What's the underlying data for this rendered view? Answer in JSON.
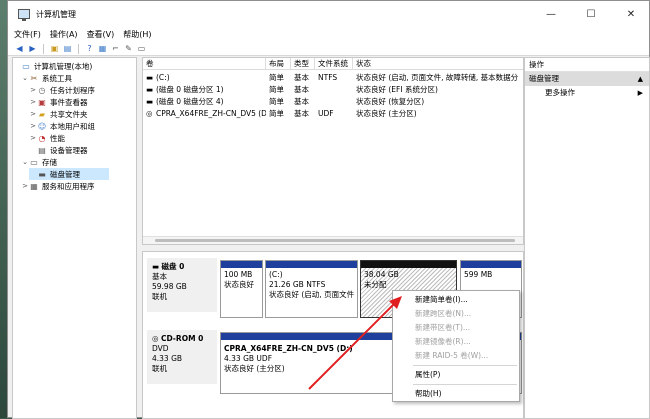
{
  "window": {
    "title": "计算机管理",
    "min": "—",
    "max": "☐",
    "close": "✕"
  },
  "menu": [
    "文件(F)",
    "操作(A)",
    "查看(V)",
    "帮助(H)"
  ],
  "tree": [
    {
      "label": "计算机管理(本地)",
      "icon": "computer-icon",
      "level": 0,
      "twisty": ""
    },
    {
      "label": "系统工具",
      "icon": "tools-icon",
      "level": 1,
      "twisty": "⌄"
    },
    {
      "label": "任务计划程序",
      "icon": "clock-icon",
      "level": 2,
      "twisty": ">"
    },
    {
      "label": "事件查看器",
      "icon": "event-viewer-icon",
      "level": 2,
      "twisty": ">"
    },
    {
      "label": "共享文件夹",
      "icon": "shared-folder-icon",
      "level": 2,
      "twisty": ">"
    },
    {
      "label": "本地用户和组",
      "icon": "users-icon",
      "level": 2,
      "twisty": ">"
    },
    {
      "label": "性能",
      "icon": "performance-icon",
      "level": 2,
      "twisty": ">"
    },
    {
      "label": "设备管理器",
      "icon": "device-manager-icon",
      "level": 2,
      "twisty": ""
    },
    {
      "label": "存储",
      "icon": "storage-icon",
      "level": 1,
      "twisty": "⌄"
    },
    {
      "label": "磁盘管理",
      "icon": "disk-management-icon",
      "level": 2,
      "twisty": "",
      "selected": true
    },
    {
      "label": "服务和应用程序",
      "icon": "services-icon",
      "level": 1,
      "twisty": ">"
    }
  ],
  "volume_table": {
    "headers": [
      "卷",
      "布局",
      "类型",
      "文件系统",
      "状态"
    ],
    "rows": [
      [
        "(C:)",
        "简单",
        "基本",
        "NTFS",
        "状态良好 (启动, 页面文件, 故障转储, 基本数据分"
      ],
      [
        "(磁盘 0 磁盘分区 1)",
        "简单",
        "基本",
        "",
        "状态良好 (EFI 系统分区)"
      ],
      [
        "(磁盘 0 磁盘分区 4)",
        "简单",
        "基本",
        "",
        "状态良好 (恢复分区)"
      ],
      [
        "CPRA_X64FRE_ZH-CN_DV5 (D:)",
        "简单",
        "基本",
        "UDF",
        "状态良好 (主分区)"
      ]
    ]
  },
  "disk0": {
    "name": "磁盘 0",
    "type": "基本",
    "size": "59.98 GB",
    "status": "联机",
    "partitions": [
      {
        "line1": "",
        "line2": "100 MB",
        "line3": "状态良好"
      },
      {
        "line1": "(C:)",
        "line2": "21.26 GB NTFS",
        "line3": "状态良好 (启动, 页面文件"
      },
      {
        "line1": "",
        "line2": "38.04 GB",
        "line3": "未分配"
      },
      {
        "line1": "",
        "line2": "599 MB",
        "line3": ""
      }
    ]
  },
  "cdrom0": {
    "name": "CD-ROM 0",
    "type": "DVD",
    "size": "4.33 GB",
    "status": "联机",
    "partition": {
      "line1": "CPRA_X64FRE_ZH-CN_DV5  (D:)",
      "line2": "4.33 GB UDF",
      "line3": "状态良好 (主分区)"
    }
  },
  "actions": {
    "header": "操作",
    "section": "磁盘管理",
    "item": "更多操作"
  },
  "context_menu": [
    {
      "label": "新建简单卷(I)...",
      "enabled": true
    },
    {
      "label": "新建跨区卷(N)...",
      "enabled": false
    },
    {
      "label": "新建带区卷(T)...",
      "enabled": false
    },
    {
      "label": "新建镜像卷(R)...",
      "enabled": false
    },
    {
      "label": "新建 RAID-5 卷(W)...",
      "enabled": false
    },
    {
      "label": "属性(P)",
      "enabled": true
    },
    {
      "label": "帮助(H)",
      "enabled": true
    }
  ],
  "colors": {
    "partition_bar": "#1f3f9c",
    "unallocated_bar": "#111111",
    "arrow": "#e02020",
    "selection": "#cce8ff"
  }
}
